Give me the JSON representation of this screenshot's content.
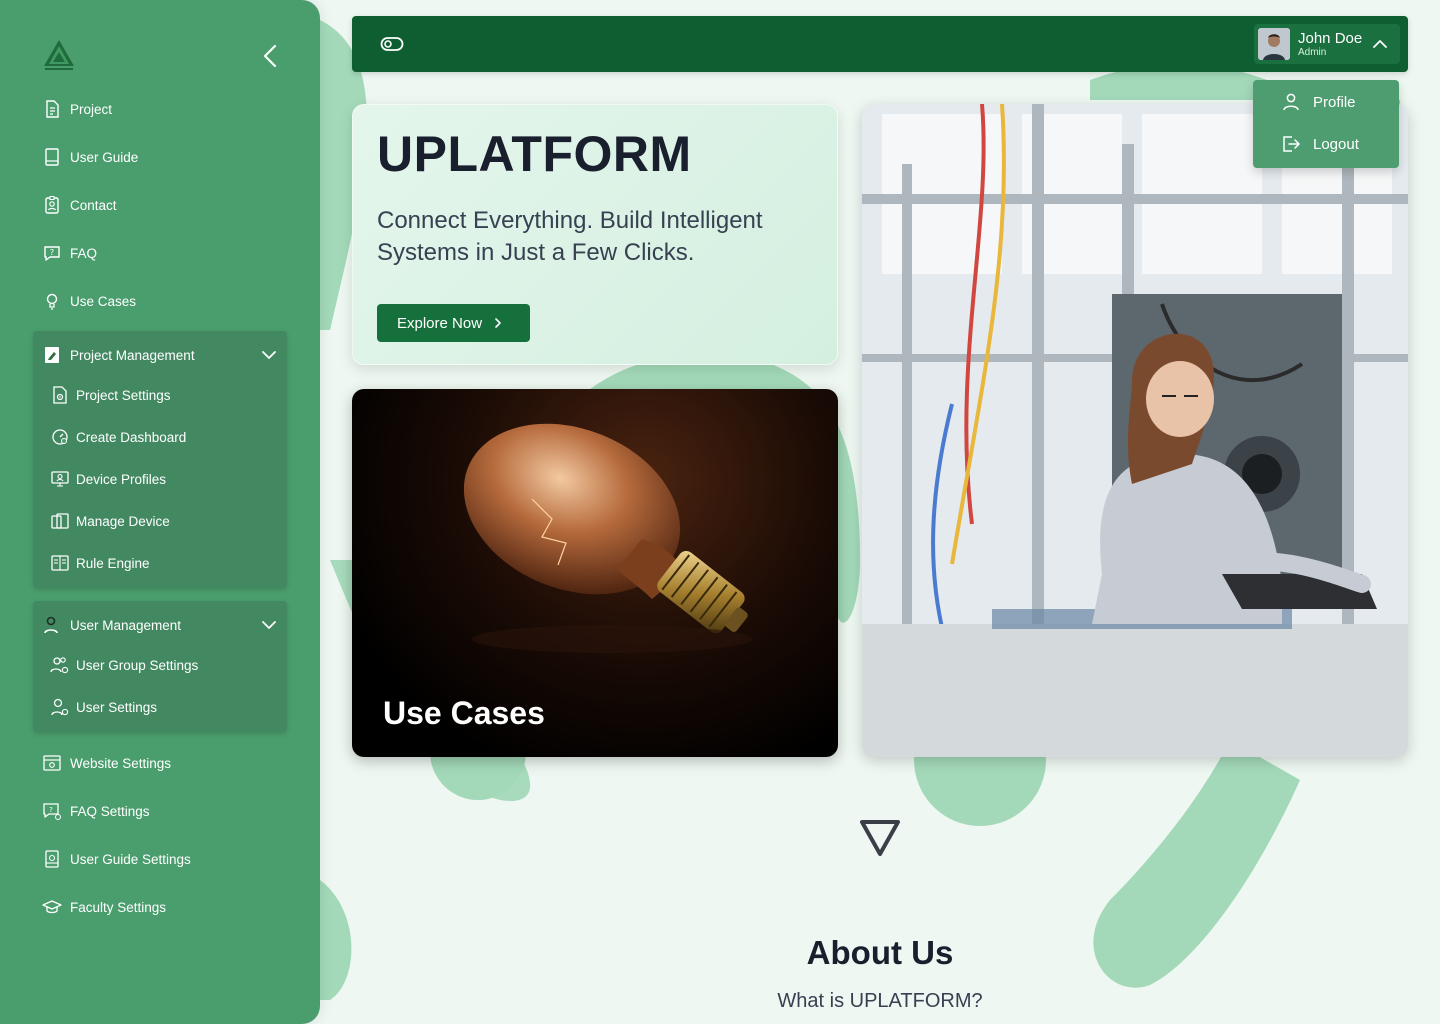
{
  "colors": {
    "sidebar_bg": "#4a9e6e",
    "topbar_bg": "#0e5e31",
    "accent": "#16703c",
    "page_bg": "#eef7f1",
    "blob": "#a3d9b9"
  },
  "sidebar": {
    "items": [
      {
        "label": "Project",
        "icon": "document-icon"
      },
      {
        "label": "User Guide",
        "icon": "book-icon"
      },
      {
        "label": "Contact",
        "icon": "id-badge-icon"
      },
      {
        "label": "FAQ",
        "icon": "question-chat-icon"
      },
      {
        "label": "Use Cases",
        "icon": "lightbulb-icon"
      }
    ],
    "project_management": {
      "label": "Project Management",
      "expanded": true,
      "items": [
        {
          "label": "Project Settings",
          "icon": "document-gear-icon"
        },
        {
          "label": "Create Dashboard",
          "icon": "dashboard-gauge-icon"
        },
        {
          "label": "Device Profiles",
          "icon": "monitor-user-icon"
        },
        {
          "label": "Manage Device",
          "icon": "devices-icon"
        },
        {
          "label": "Rule Engine",
          "icon": "open-book-icon"
        }
      ]
    },
    "user_management": {
      "label": "User Management",
      "expanded": true,
      "items": [
        {
          "label": "User Group Settings",
          "icon": "users-gear-icon"
        },
        {
          "label": "User Settings",
          "icon": "user-gear-icon"
        }
      ]
    },
    "bottom_items": [
      {
        "label": "Website Settings",
        "icon": "browser-gear-icon"
      },
      {
        "label": "FAQ Settings",
        "icon": "question-chat-gear-icon"
      },
      {
        "label": "User Guide Settings",
        "icon": "book-gear-icon"
      },
      {
        "label": "Faculty Settings",
        "icon": "graduation-cap-icon"
      }
    ]
  },
  "topbar": {
    "user": {
      "name": "John Doe",
      "role": "Admin"
    },
    "menu": {
      "profile_label": "Profile",
      "logout_label": "Logout"
    }
  },
  "hero": {
    "title": "UPLATFORM",
    "subtitle": "Connect Everything. Build Intelligent Systems in Just a Few Clicks.",
    "cta_label": "Explore Now"
  },
  "use_cases_card": {
    "label": "Use Cases"
  },
  "about": {
    "title": "About Us",
    "subtitle": "What is UPLATFORM?"
  }
}
